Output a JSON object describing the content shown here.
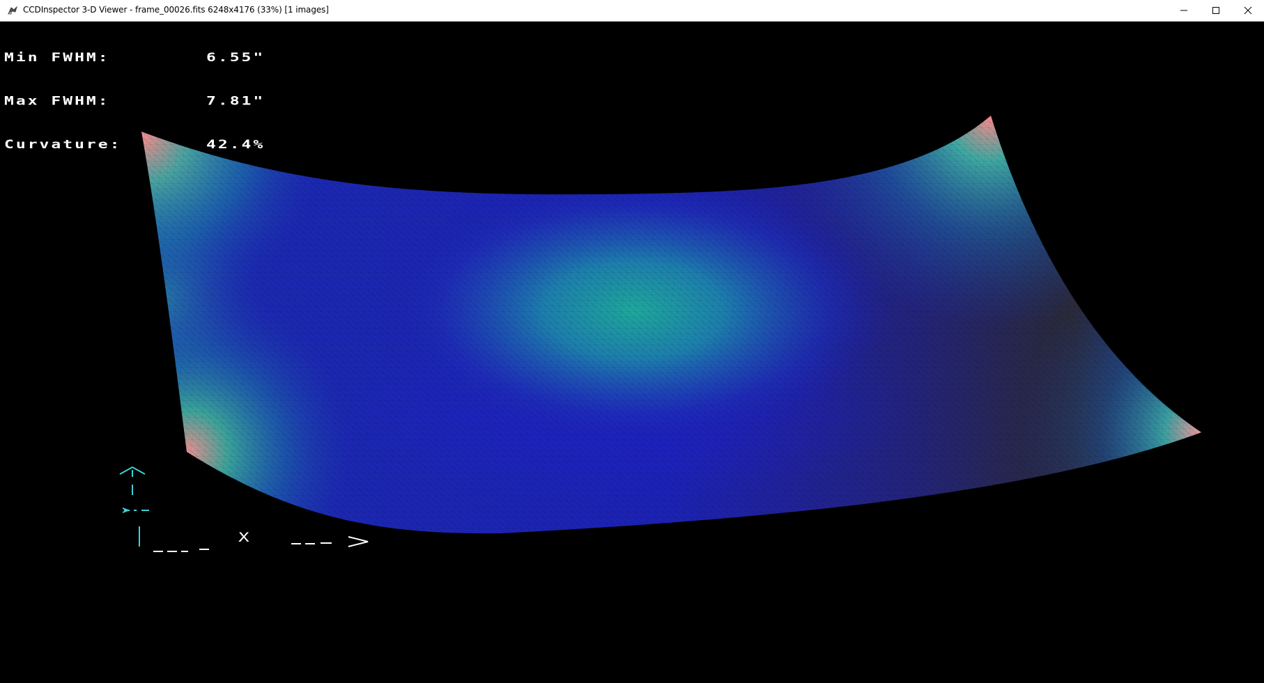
{
  "window": {
    "title": "CCDInspector 3-D Viewer - frame_00026.fits 6248x4176 (33%)  [1 images]",
    "icon": "ccdinspector-app-icon",
    "buttons": {
      "minimize": "minimize-icon",
      "maximize": "maximize-icon",
      "close": "close-icon"
    }
  },
  "stats": {
    "min_fwhm": {
      "label": "Min FWHM:",
      "value": "6.55\""
    },
    "max_fwhm": {
      "label": "Max FWHM:",
      "value": "7.81\""
    },
    "curvature": {
      "label": "Curvature:",
      "value": "42.4%"
    }
  },
  "axes": {
    "x_label": "X",
    "y_arrow_color": "#3fd0d8",
    "x_arrow_color": "#ffffff"
  },
  "colors": {
    "background": "#000000",
    "surface_low": "#1a1fb8",
    "surface_mid": "#1aa59a",
    "surface_high": "#e88a8a",
    "surface_dark": "#2a2a2e"
  }
}
